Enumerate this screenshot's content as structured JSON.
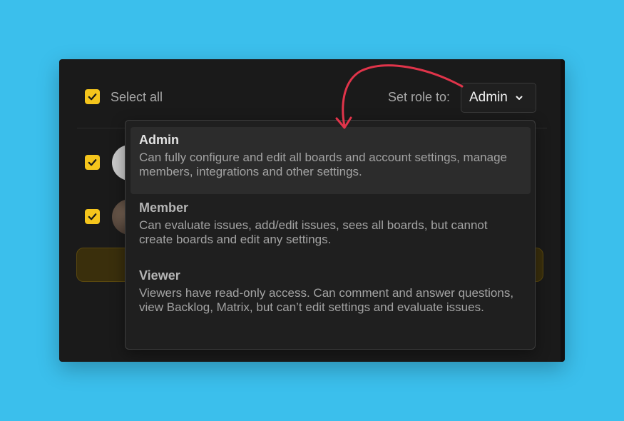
{
  "header": {
    "select_all_label": "Select all",
    "set_role_label": "Set role to:",
    "role_value": "Admin"
  },
  "dropdown": {
    "options": [
      {
        "title": "Admin",
        "description": "Can fully configure and edit all boards and account settings, manage members, integrations and other settings."
      },
      {
        "title": "Member",
        "description": "Can evaluate issues, add/edit issues, sees all boards, but cannot create boards and edit any settings."
      },
      {
        "title": "Viewer",
        "description": "Viewers have read-only access. Can comment and answer questions, view Backlog, Matrix, but can’t edit settings and evaluate issues."
      }
    ],
    "selected": "Admin"
  },
  "colors": {
    "background": "#3bbfec",
    "panel": "#1a1a1a",
    "checkbox": "#f5c51c",
    "annotation_arrow": "#e0344a"
  },
  "icons": [
    "check-icon",
    "chevron-down-icon",
    "annotation-arrow"
  ]
}
